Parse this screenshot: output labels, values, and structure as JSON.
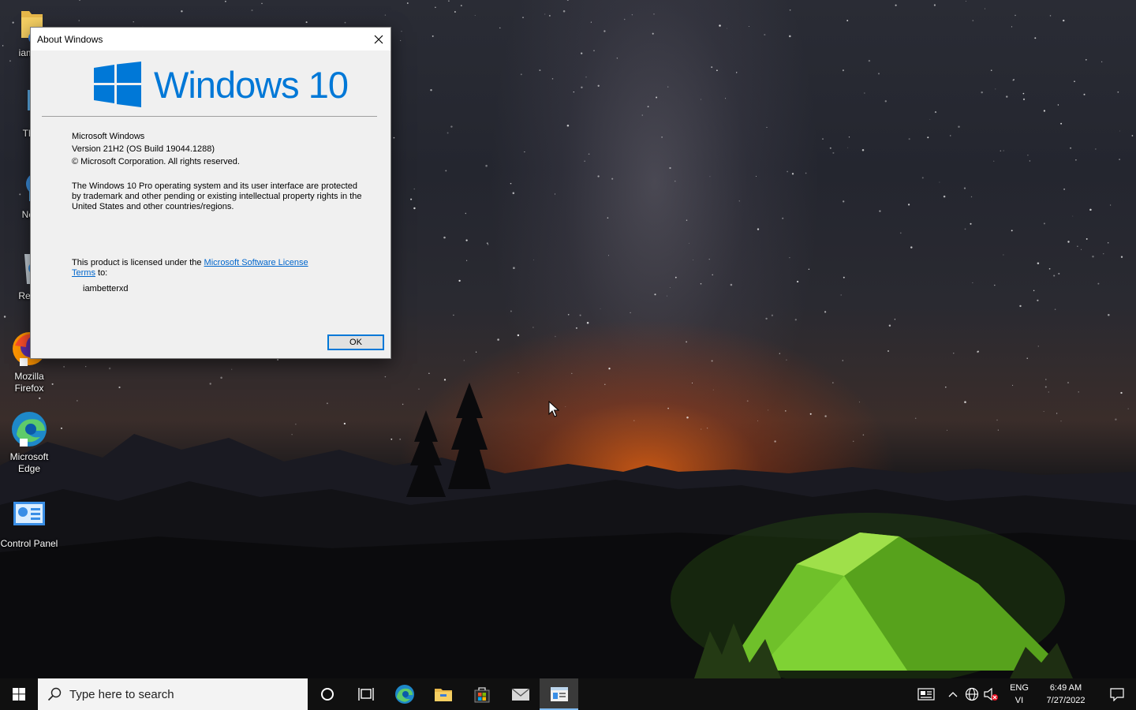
{
  "desktop": {
    "icons": [
      {
        "label": "iambe",
        "icon": "folder-icon"
      },
      {
        "label": "This",
        "icon": "this-pc-icon"
      },
      {
        "label": "Netv",
        "icon": "network-icon"
      },
      {
        "label": "Recyc",
        "icon": "recycle-bin-icon"
      },
      {
        "label": "Mozilla Firefox",
        "icon": "firefox-icon"
      },
      {
        "label": "Microsoft Edge",
        "icon": "edge-icon"
      },
      {
        "label": "Control Panel",
        "icon": "control-panel-icon"
      }
    ]
  },
  "dialog": {
    "title": "About Windows",
    "logo_text": "Windows 10",
    "product_name": "Microsoft Windows",
    "version": "Version 21H2 (OS Build 19044.1288)",
    "copyright": "© Microsoft Corporation. All rights reserved.",
    "legal_text": "The Windows 10 Pro operating system and its user interface are protected by trademark and other pending or existing intellectual property rights in the United States and other countries/regions.",
    "license_prefix": "This product is licensed under the ",
    "license_link": "Microsoft Software License Terms",
    "license_suffix": " to:",
    "licensee": "iambetterxd",
    "ok_label": "OK"
  },
  "taskbar": {
    "search_placeholder": "Type here to search",
    "apps": [
      "cortana-icon",
      "task-view-icon",
      "edge-icon",
      "file-explorer-icon",
      "store-icon",
      "mail-icon",
      "about-windows-icon"
    ],
    "tray": {
      "language_top": "ENG",
      "language_bottom": "VI",
      "time": "6:49 AM",
      "date": "7/27/2022"
    }
  },
  "colors": {
    "accent": "#0078d7",
    "taskbar": "#101010",
    "dialog_bg": "#f0f0f0"
  }
}
